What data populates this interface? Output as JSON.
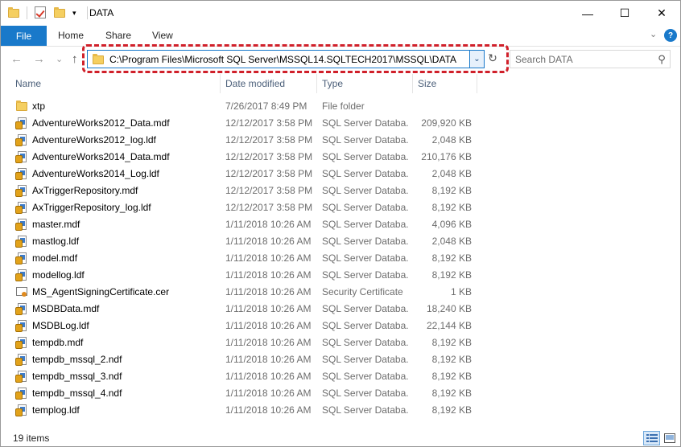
{
  "window": {
    "title": "DATA",
    "minimize_glyph": "—",
    "maximize_glyph": "☐",
    "close_glyph": "✕"
  },
  "ribbon": {
    "file_tab": "File",
    "tabs": [
      "Home",
      "Share",
      "View"
    ],
    "expand_glyph": "⌄",
    "help_glyph": "?"
  },
  "navigation": {
    "back_glyph": "←",
    "forward_glyph": "→",
    "recent_glyph": "⌄",
    "up_glyph": "↑",
    "address_path": "C:\\Program Files\\Microsoft SQL Server\\MSSQL14.SQLTECH2017\\MSSQL\\DATA",
    "address_dropdown_glyph": "⌄",
    "refresh_glyph": "↻",
    "search_placeholder": "Search DATA",
    "search_icon": "magnifier-icon"
  },
  "columns": {
    "name": "Name",
    "date_modified": "Date modified",
    "type": "Type",
    "size": "Size"
  },
  "files": [
    {
      "name": "xtp",
      "date": "7/26/2017 8:49 PM",
      "type": "File folder",
      "size": "",
      "icon": "folder"
    },
    {
      "name": "AdventureWorks2012_Data.mdf",
      "date": "12/12/2017 3:58 PM",
      "type": "SQL Server Databa...",
      "size": "209,920 KB",
      "icon": "database"
    },
    {
      "name": "AdventureWorks2012_log.ldf",
      "date": "12/12/2017 3:58 PM",
      "type": "SQL Server Databa...",
      "size": "2,048 KB",
      "icon": "database"
    },
    {
      "name": "AdventureWorks2014_Data.mdf",
      "date": "12/12/2017 3:58 PM",
      "type": "SQL Server Databa...",
      "size": "210,176 KB",
      "icon": "database"
    },
    {
      "name": "AdventureWorks2014_Log.ldf",
      "date": "12/12/2017 3:58 PM",
      "type": "SQL Server Databa...",
      "size": "2,048 KB",
      "icon": "database"
    },
    {
      "name": "AxTriggerRepository.mdf",
      "date": "12/12/2017 3:58 PM",
      "type": "SQL Server Databa...",
      "size": "8,192 KB",
      "icon": "database"
    },
    {
      "name": "AxTriggerRepository_log.ldf",
      "date": "12/12/2017 3:58 PM",
      "type": "SQL Server Databa...",
      "size": "8,192 KB",
      "icon": "database"
    },
    {
      "name": "master.mdf",
      "date": "1/11/2018 10:26 AM",
      "type": "SQL Server Databa...",
      "size": "4,096 KB",
      "icon": "database"
    },
    {
      "name": "mastlog.ldf",
      "date": "1/11/2018 10:26 AM",
      "type": "SQL Server Databa...",
      "size": "2,048 KB",
      "icon": "database"
    },
    {
      "name": "model.mdf",
      "date": "1/11/2018 10:26 AM",
      "type": "SQL Server Databa...",
      "size": "8,192 KB",
      "icon": "database"
    },
    {
      "name": "modellog.ldf",
      "date": "1/11/2018 10:26 AM",
      "type": "SQL Server Databa...",
      "size": "8,192 KB",
      "icon": "database"
    },
    {
      "name": "MS_AgentSigningCertificate.cer",
      "date": "1/11/2018 10:26 AM",
      "type": "Security Certificate",
      "size": "1 KB",
      "icon": "certificate"
    },
    {
      "name": "MSDBData.mdf",
      "date": "1/11/2018 10:26 AM",
      "type": "SQL Server Databa...",
      "size": "18,240 KB",
      "icon": "database"
    },
    {
      "name": "MSDBLog.ldf",
      "date": "1/11/2018 10:26 AM",
      "type": "SQL Server Databa...",
      "size": "22,144 KB",
      "icon": "database"
    },
    {
      "name": "tempdb.mdf",
      "date": "1/11/2018 10:26 AM",
      "type": "SQL Server Databa...",
      "size": "8,192 KB",
      "icon": "database"
    },
    {
      "name": "tempdb_mssql_2.ndf",
      "date": "1/11/2018 10:26 AM",
      "type": "SQL Server Databa...",
      "size": "8,192 KB",
      "icon": "database"
    },
    {
      "name": "tempdb_mssql_3.ndf",
      "date": "1/11/2018 10:26 AM",
      "type": "SQL Server Databa...",
      "size": "8,192 KB",
      "icon": "database"
    },
    {
      "name": "tempdb_mssql_4.ndf",
      "date": "1/11/2018 10:26 AM",
      "type": "SQL Server Databa...",
      "size": "8,192 KB",
      "icon": "database"
    },
    {
      "name": "templog.ldf",
      "date": "1/11/2018 10:26 AM",
      "type": "SQL Server Databa...",
      "size": "8,192 KB",
      "icon": "database"
    }
  ],
  "status": {
    "item_count": "19 items",
    "details_view_icon": "details-view-icon",
    "large_icons_view_icon": "large-icons-view-icon"
  },
  "colors": {
    "accent": "#1979ca",
    "highlight_outline": "#d0202a",
    "folder": "#f5cf61"
  }
}
